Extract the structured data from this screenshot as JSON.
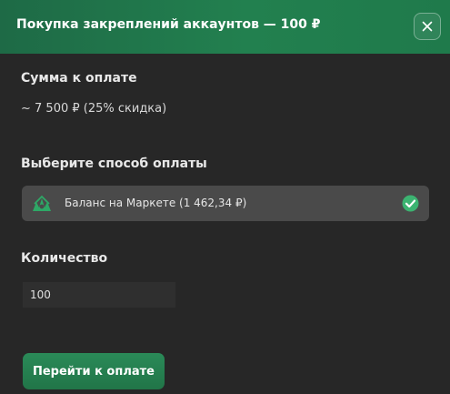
{
  "modal": {
    "title": "Покупка закреплений аккаунтов — 100 ₽"
  },
  "sum": {
    "heading": "Сумма к оплате",
    "value": "~ 7 500 ₽ (25% скидка)"
  },
  "payment": {
    "heading": "Выберите способ оплаты",
    "options": [
      {
        "label": "Баланс на Маркете (1 462,34 ₽)",
        "icon": "market-logo-icon",
        "selected": true
      }
    ]
  },
  "quantity": {
    "heading": "Количество",
    "value": "100"
  },
  "actions": {
    "submit_label": "Перейти к оплате"
  },
  "colors": {
    "accent": "#22804f",
    "check": "#3cb371",
    "background": "#272727"
  }
}
